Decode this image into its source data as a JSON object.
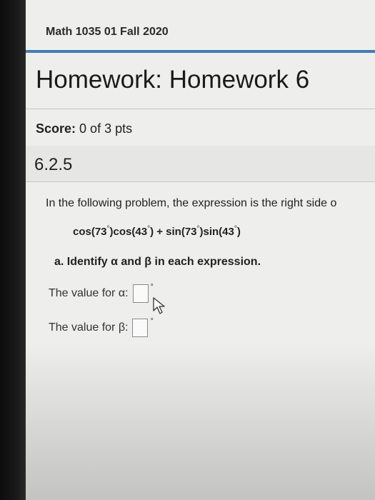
{
  "header": {
    "course": "Math 1035 01 Fall 2020"
  },
  "assignment": {
    "title": "Homework: Homework 6"
  },
  "score": {
    "label": "Score:",
    "value": "0 of 3 pts"
  },
  "question": {
    "number": "6.2.5",
    "prompt": "In the following problem, the expression is the right side o",
    "expression": {
      "cos1": "cos(73",
      "deg1": "°",
      "cos2": ")cos(43",
      "deg2": "°",
      "mid": ") + sin(73",
      "deg3": "°",
      "sin2": ")sin(43",
      "deg4": "°",
      "end": ")"
    },
    "part_a": "a. Identify α and β in each expression.",
    "alpha_label": "The value for α:",
    "beta_label": "The value for β:",
    "degree_symbol": "°"
  },
  "colors": {
    "accent": "#3f7fb3"
  }
}
